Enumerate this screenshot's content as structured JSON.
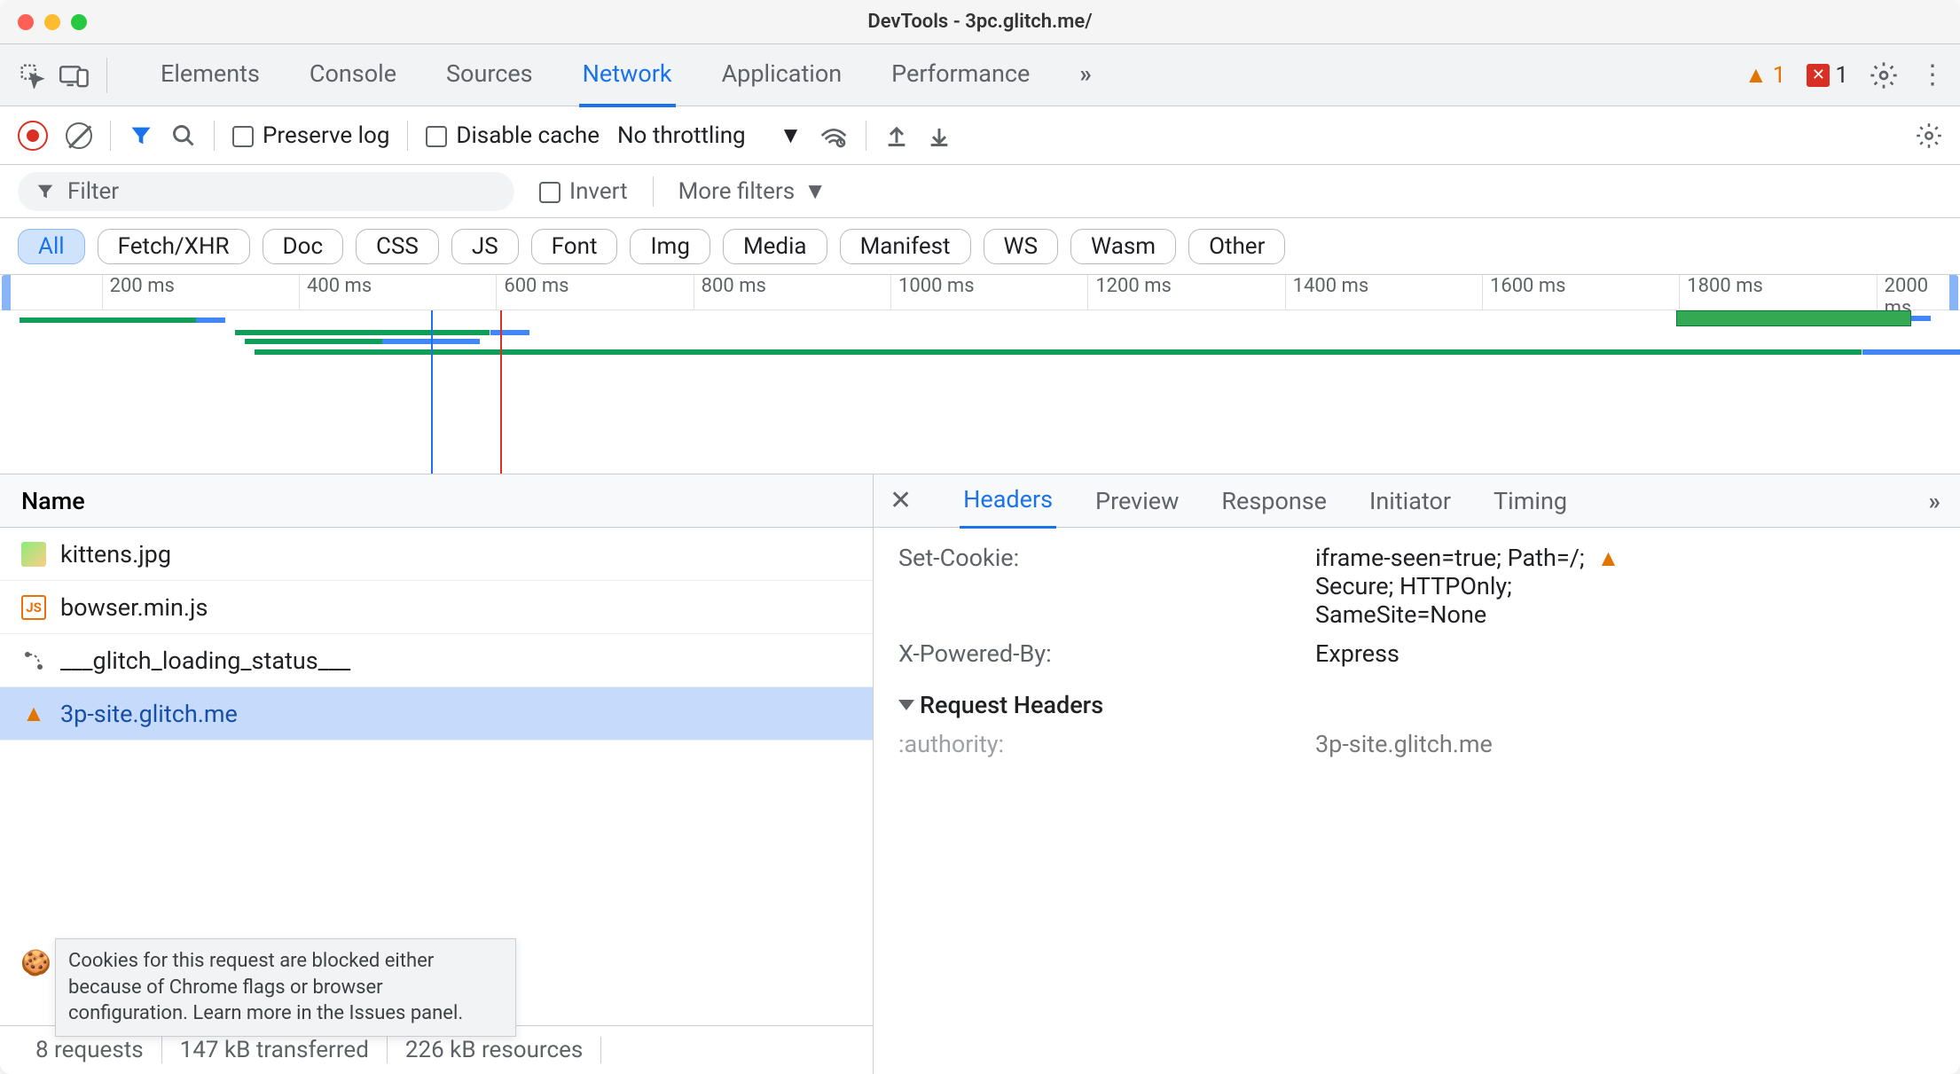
{
  "window": {
    "title": "DevTools - 3pc.glitch.me/"
  },
  "tabs": {
    "panels": [
      "Elements",
      "Console",
      "Sources",
      "Network",
      "Application",
      "Performance"
    ],
    "active": "Network",
    "warn_count": "1",
    "err_count": "1"
  },
  "toolbar": {
    "preserve_log": "Preserve log",
    "disable_cache": "Disable cache",
    "throttling": "No throttling"
  },
  "filterRow": {
    "placeholder": "Filter",
    "invert": "Invert",
    "more_filters": "More filters"
  },
  "chips": [
    "All",
    "Fetch/XHR",
    "Doc",
    "CSS",
    "JS",
    "Font",
    "Img",
    "Media",
    "Manifest",
    "WS",
    "Wasm",
    "Other"
  ],
  "chip_active": "All",
  "overview": {
    "ticks": [
      "200 ms",
      "400 ms",
      "600 ms",
      "800 ms",
      "1000 ms",
      "1200 ms",
      "1400 ms",
      "1600 ms",
      "1800 ms",
      "2000 ms"
    ]
  },
  "requests": {
    "header": "Name",
    "rows": [
      {
        "icon": "image",
        "name": "kittens.jpg",
        "selected": false
      },
      {
        "icon": "js",
        "name": "bowser.min.js",
        "selected": false
      },
      {
        "icon": "other",
        "name": "___glitch_loading_status___",
        "selected": false
      },
      {
        "icon": "warn",
        "name": "3p-site.glitch.me",
        "selected": true
      }
    ],
    "tooltip": "Cookies for this request are blocked either because of Chrome flags or browser configuration. Learn more in the Issues panel."
  },
  "status": {
    "requests": "8 requests",
    "transferred": "147 kB transferred",
    "resources": "226 kB resources"
  },
  "details": {
    "tabs": [
      "Headers",
      "Preview",
      "Response",
      "Initiator",
      "Timing"
    ],
    "active": "Headers",
    "set_cookie_label": "Set-Cookie:",
    "set_cookie_lines": [
      "iframe-seen=true; Path=/;",
      "Secure; HTTPOnly;",
      "SameSite=None"
    ],
    "x_powered_label": "X-Powered-By:",
    "x_powered_value": "Express",
    "req_headers_title": "Request Headers",
    "authority_label": ":authority:",
    "authority_value": "3p-site.glitch.me"
  }
}
